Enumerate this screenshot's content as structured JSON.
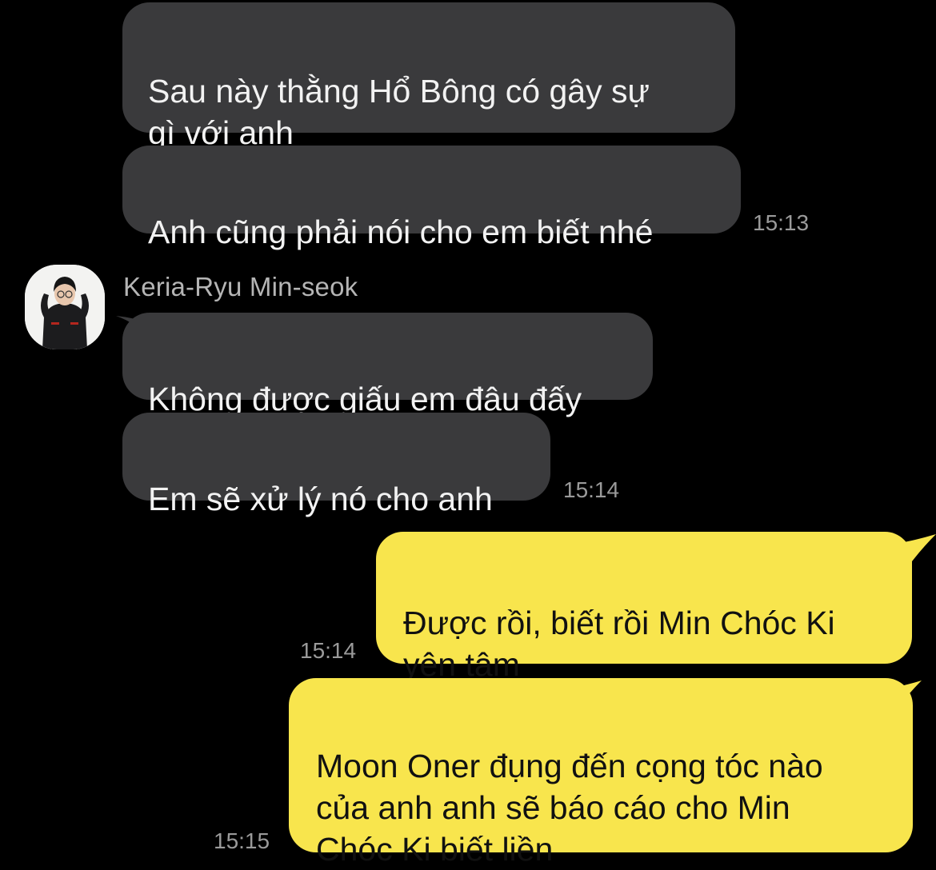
{
  "colors": {
    "background": "#000000",
    "incoming_bubble": "#3a3a3c",
    "outgoing_bubble": "#f8e54d",
    "timestamp": "#9a9a9a"
  },
  "contact": {
    "name": "Keria-Ryu Min-seok",
    "avatar": "user-avatar-icon"
  },
  "messages": [
    {
      "text": "Sau này thằng Hổ Bông có gây sự\ngì với anh",
      "direction": "incoming"
    },
    {
      "text": "Anh cũng phải nói cho em biết nhé",
      "direction": "incoming",
      "time": "15:13"
    },
    {
      "text": "Không được giấu em đâu đấy",
      "direction": "incoming"
    },
    {
      "text": "Em sẽ xử lý nó cho anh",
      "direction": "incoming",
      "time": "15:14"
    },
    {
      "text": "Được rồi, biết rồi Min Chóc Ki\nyên tâm",
      "direction": "outgoing",
      "time": "15:14"
    },
    {
      "text": "Moon Oner đụng đến cọng tóc nào\ncủa anh anh sẽ báo cáo cho Min\nChóc Ki biết liền",
      "direction": "outgoing",
      "time": "15:15"
    }
  ]
}
